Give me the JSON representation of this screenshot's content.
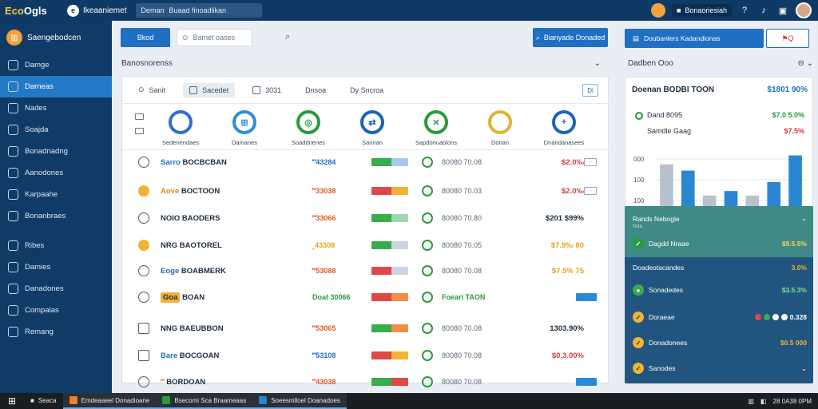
{
  "topbar": {
    "logo_a": "Eco",
    "logo_b": "Ogls",
    "brand_badge": "e",
    "brand_name": "Ikeaaniemet",
    "search_label": "Deman",
    "search_value": "Buaad finoadlikan",
    "account_label": "Bonaoriesiah"
  },
  "sidebar": {
    "header": "Saengebodcen",
    "items": [
      {
        "label": "Damge"
      },
      {
        "label": "Darneas"
      },
      {
        "label": "Nades"
      },
      {
        "label": "Soajda"
      },
      {
        "label": "Bonadnadng"
      },
      {
        "label": "Aanodones"
      },
      {
        "label": "Karpaahe"
      },
      {
        "label": "Bonanbraes"
      },
      {
        "label": "Ribes"
      },
      {
        "label": "Damies"
      },
      {
        "label": "Danadones"
      },
      {
        "label": "Compalas"
      },
      {
        "label": "Remang"
      }
    ]
  },
  "main": {
    "new_button": "Bkod",
    "search_placeholder": "Bamet oases",
    "action_button": "Bianyade Donaded",
    "section_title": "Banosnorenss",
    "tabs": [
      {
        "label": "Sanit"
      },
      {
        "label": "Sacedet"
      },
      {
        "label": "3031"
      },
      {
        "label": "Dnsoa"
      },
      {
        "label": "Dy Sncroa"
      }
    ],
    "tab_action": "Di",
    "categories": [
      {
        "label": "Sedenendaes",
        "icon": "donut-chart-icon",
        "glyph": "",
        "color": "#2d6fcf"
      },
      {
        "label": "Damanes",
        "icon": "grid-icon",
        "glyph": "⊞",
        "color": "#2f8fd8"
      },
      {
        "label": "Soaddnenes",
        "icon": "target-icon",
        "glyph": "◎",
        "color": "#2a9a3c"
      },
      {
        "label": "Sanrian",
        "icon": "swap-icon",
        "glyph": "⇄",
        "color": "#1f64b0"
      },
      {
        "label": "Sapdonuaolons",
        "icon": "shuffle-icon",
        "glyph": "✕",
        "color": "#2a9a3c"
      },
      {
        "label": "Donan",
        "icon": "pie-ring-icon",
        "glyph": "",
        "color": "#e0b23a"
      },
      {
        "label": "Dnandanasees",
        "icon": "plus-icon",
        "glyph": "+",
        "color": "#1f64b0"
      }
    ],
    "rows": [
      {
        "prefix": "Sarro",
        "name": "BOCBCBAN",
        "code": "‴43284",
        "code_color": "#1f6fc2",
        "ref": "80080 70.08",
        "value": "$2.0‰",
        "value_color": "#d23c3c",
        "bar": [
          "#3aab4f",
          "#a9c9ec"
        ]
      },
      {
        "prefix": "Aove",
        "name": "BOCTOON",
        "code": "‴33038",
        "code_color": "#e25a22",
        "ref": "80080 70.03",
        "value": "$2.0‰",
        "value_color": "#d23c3c",
        "bar": [
          "#e04848",
          "#f2b233"
        ]
      },
      {
        "prefix": "",
        "name": "NOIO BAODERS",
        "code": "‴33066",
        "code_color": "#e25a22",
        "ref": "80080 70.80",
        "value": "$201 $99%",
        "value_color": "#1f2d3d",
        "bar": [
          "#3aab4f",
          "#9fd8b0"
        ]
      },
      {
        "prefix": "",
        "name": "NRG BAOTOREL",
        "code": "‸43308",
        "code_color": "#e8a11c",
        "ref": "80080 70.05",
        "value": "$7.9‰  80",
        "value_color": "#e8a11c",
        "bar": [
          "#3aab4f",
          "#c9d4e0"
        ]
      },
      {
        "prefix": "Eoge",
        "name": "BOABMERK",
        "code": "‴53088",
        "code_color": "#e25a22",
        "ref": "80080 70.08",
        "value": "$7.5%  75",
        "value_color": "#e8a11c",
        "bar": [
          "#e04848",
          "#c9d4e0"
        ]
      },
      {
        "prefix": "Goa",
        "name": "BOAN",
        "code": "Doat 30066",
        "code_color": "#2a9a3c",
        "ref": "Foeari TAON",
        "value": "",
        "value_color": "#1f2d3d",
        "bar": [
          "#e04848",
          "#f28c4a"
        ]
      },
      {
        "prefix": "",
        "name": "NNG BAEUBBON",
        "code": "‴53065",
        "code_color": "#e25a22",
        "ref": "80080 70.08",
        "value": "1303.90%",
        "value_color": "#1f2d3d",
        "bar": [
          "#3aab4f",
          "#f28c4a"
        ]
      },
      {
        "prefix": "Bare",
        "name": "BOCGOAN",
        "code": "‴53108",
        "code_color": "#1f6fc2",
        "ref": "80080 70.08",
        "value": "$0.3.00%",
        "value_color": "#d23c3c",
        "bar": [
          "#e04848",
          "#f2b233"
        ]
      },
      {
        "prefix": "‴",
        "name": "BORDOAN",
        "code": "‴43038",
        "code_color": "#e25a22",
        "ref": "80080 70.08",
        "value": "",
        "value_color": "#1f2d3d",
        "bar": [
          "#3aab4f",
          "#e04848"
        ]
      }
    ]
  },
  "right": {
    "main_button": "Doubanlers Kadandionas",
    "flag_button": "Q",
    "title": "Dadben Ooo",
    "card": {
      "head": "Doenan BODBI TOON",
      "head_value": "$1801 90%",
      "line1": "Dand 8095",
      "line1_value": "$7.0 5.0%",
      "line2": "Samdle Gaag",
      "line2_value": "$7.5%",
      "y_ticks": [
        "000",
        "100",
        "100"
      ]
    },
    "chart_data": {
      "type": "bar",
      "values": [
        55,
        48,
        20,
        25,
        20,
        35,
        65
      ],
      "colors": [
        "#b9c2cc",
        "#2a86d0",
        "#b9c2cc",
        "#2a86d0",
        "#b9c2cc",
        "#2a86d0",
        "#2a86d0"
      ],
      "ylim": [
        0,
        70
      ]
    },
    "panel": {
      "title": "Rands Nebogle",
      "sub": "Nda",
      "rows": [
        {
          "label": "Dagdd Nraae",
          "value": "$9.5.5%",
          "icon_color": "#2a9a3c",
          "glyph": "✓"
        },
        {
          "label": "Doadeotacandes",
          "value": "3.0%",
          "icon_color": "",
          "glyph": ""
        },
        {
          "label": "Sonadedes",
          "value": "$3.5.3%",
          "icon_color": "#3aab4f",
          "glyph": "●"
        },
        {
          "label": "Doraeae",
          "value": "0.328",
          "icon_color": "#f2b233",
          "glyph": "✓"
        },
        {
          "label": "Donadonees",
          "value": "$0.5 000",
          "icon_color": "#f2b233",
          "glyph": "✓"
        },
        {
          "label": "Sanodes",
          "value": "",
          "icon_color": "#f2b233",
          "glyph": "✓"
        }
      ]
    }
  },
  "taskbar": {
    "search": "Seaca",
    "apps": [
      {
        "label": "Emdeaaeel Donadioane",
        "color": "#e8822c"
      },
      {
        "label": "Bsecomi Sca Braameaas",
        "color": "#2a9a3c"
      },
      {
        "label": "Soeesmlloel Doanadoes",
        "color": "#2a86d0"
      }
    ],
    "tray": "28 0A38 0PM"
  }
}
